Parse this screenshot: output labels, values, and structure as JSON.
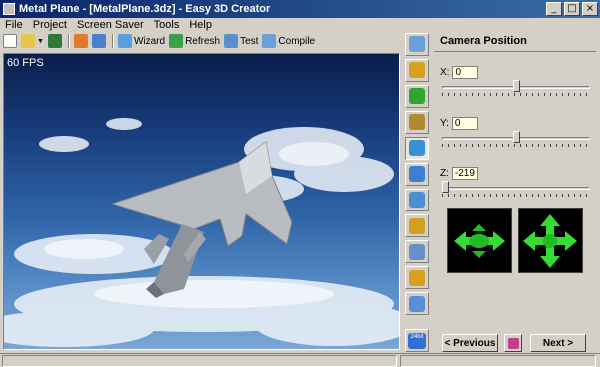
{
  "window": {
    "title": "Metal Plane - [MetalPlane.3dz] - Easy 3D Creator",
    "minimize": "_",
    "maximize": "□",
    "close": "×"
  },
  "menu": [
    "File",
    "Project",
    "Screen Saver",
    "Tools",
    "Help"
  ],
  "toolbar": {
    "wizard": "Wizard",
    "refresh": "Refresh",
    "test": "Test",
    "compile": "Compile"
  },
  "viewport": {
    "fps": "60 FPS"
  },
  "side_tools": [
    {
      "icon": "cube-icon",
      "color": "#6a9fd8"
    },
    {
      "icon": "checker-texture-icon",
      "color": "#d8a020"
    },
    {
      "icon": "rotate-icon",
      "color": "#2fa52f"
    },
    {
      "icon": "cube-effects-icon",
      "color": "#b08a30"
    },
    {
      "icon": "camera-icon",
      "color": "#3b8fd6"
    },
    {
      "icon": "snowflake-icon",
      "color": "#3b7fd6"
    },
    {
      "icon": "music-note-icon",
      "color": "#4a8fd6"
    },
    {
      "icon": "tools-icon",
      "color": "#d0a020"
    },
    {
      "icon": "window-icon",
      "color": "#6a8fc8"
    },
    {
      "icon": "coins-icon",
      "color": "#d8a020"
    },
    {
      "icon": "gears-icon",
      "color": "#5a8fd6"
    },
    {
      "icon": "bit-depth-icon",
      "color": "#2f6fd6"
    }
  ],
  "bit_depth_label": "24bit",
  "panel": {
    "title": "Camera Position",
    "x_label": "X:",
    "x_value": "0",
    "x_position": 0.5,
    "y_label": "Y:",
    "y_value": "0",
    "y_position": 0.5,
    "z_label": "Z:",
    "z_value": "-219",
    "z_position": 0.0
  },
  "buttons": {
    "previous": "< Previous",
    "next": "Next >"
  }
}
